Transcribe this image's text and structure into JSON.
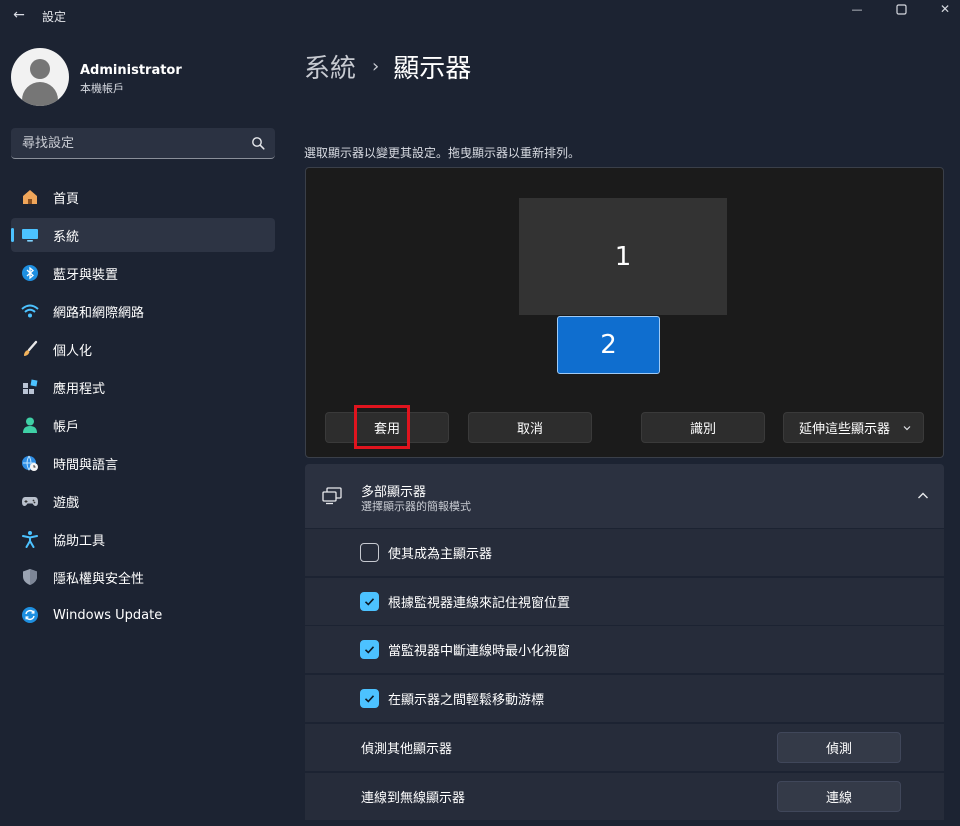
{
  "window": {
    "title": "設定",
    "back_glyph": "←",
    "minimize_glyph": "—",
    "close_glyph": "✕"
  },
  "account": {
    "name": "Administrator",
    "type": "本機帳戶"
  },
  "search": {
    "placeholder": "尋找設定"
  },
  "sidebar": {
    "items": [
      {
        "label": "首頁",
        "icon": "home-icon",
        "active": false
      },
      {
        "label": "系統",
        "icon": "system-display-icon",
        "active": true
      },
      {
        "label": "藍牙與裝置",
        "icon": "bluetooth-icon",
        "active": false
      },
      {
        "label": "網路和網際網路",
        "icon": "wifi-icon",
        "active": false
      },
      {
        "label": "個人化",
        "icon": "brush-icon",
        "active": false
      },
      {
        "label": "應用程式",
        "icon": "apps-icon",
        "active": false
      },
      {
        "label": "帳戶",
        "icon": "person-icon",
        "active": false
      },
      {
        "label": "時間與語言",
        "icon": "globe-clock-icon",
        "active": false
      },
      {
        "label": "遊戲",
        "icon": "gamepad-icon",
        "active": false
      },
      {
        "label": "協助工具",
        "icon": "accessibility-icon",
        "active": false
      },
      {
        "label": "隱私權與安全性",
        "icon": "shield-icon",
        "active": false
      },
      {
        "label": "Windows Update",
        "icon": "update-icon",
        "active": false
      }
    ]
  },
  "header": {
    "parent": "系統",
    "separator": "›",
    "current": "顯示器"
  },
  "arrangement": {
    "hint": "選取顯示器以變更其設定。拖曳顯示器以重新排列。",
    "monitors": [
      {
        "label": "1",
        "selected": false
      },
      {
        "label": "2",
        "selected": true
      }
    ],
    "apply_label": "套用",
    "cancel_label": "取消",
    "identify_label": "識別",
    "mode_label": "延伸這些顯示器"
  },
  "multiple_displays": {
    "title": "多部顯示器",
    "subtitle": "選擇顯示器的簡報模式",
    "options": [
      {
        "label": "使其成為主顯示器",
        "checked": false
      },
      {
        "label": "根據監視器連線來記住視窗位置",
        "checked": true
      },
      {
        "label": "當監視器中斷連線時最小化視窗",
        "checked": true
      },
      {
        "label": "在顯示器之間輕鬆移動游標",
        "checked": true
      }
    ],
    "detect": {
      "label": "偵測其他顯示器",
      "button": "偵測"
    },
    "wireless": {
      "label": "連線到無線顯示器",
      "button": "連線"
    }
  },
  "colors": {
    "accent": "#4cc2ff",
    "selected_monitor": "#0f6ecf",
    "highlight": "#e0141e"
  }
}
